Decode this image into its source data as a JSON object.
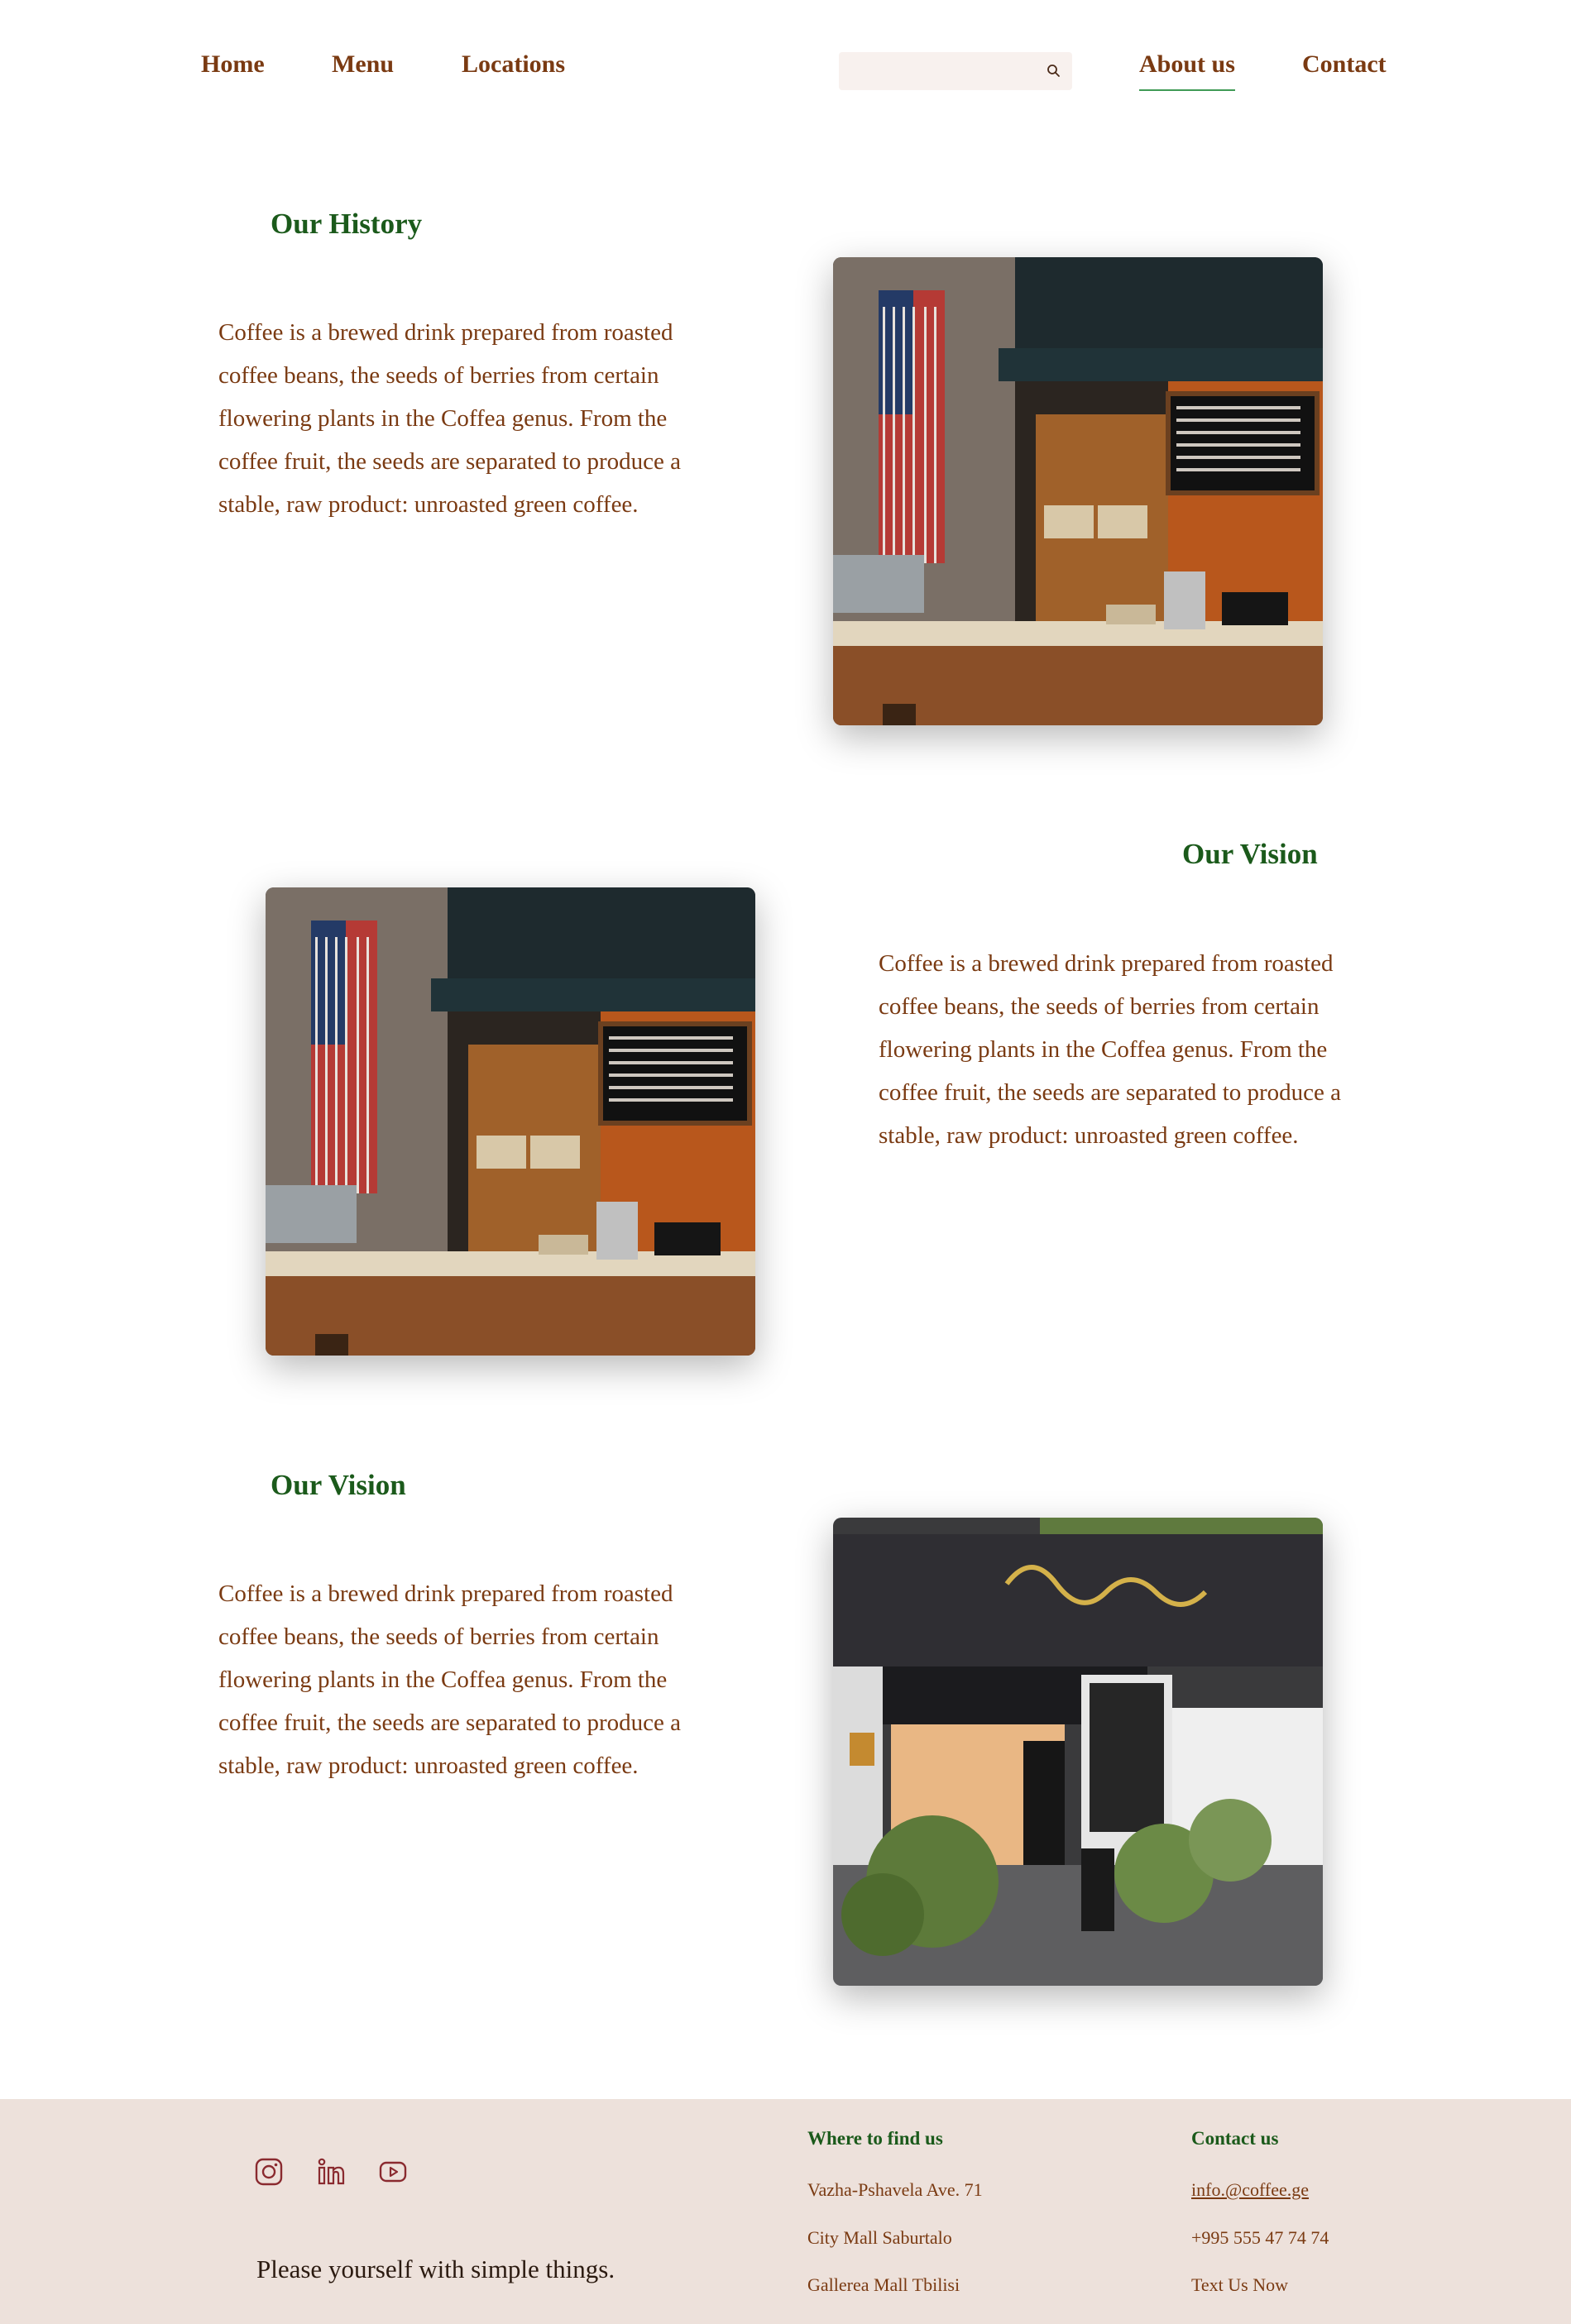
{
  "nav": {
    "home": "Home",
    "menu": "Menu",
    "locations": "Locations",
    "about": "About us",
    "contact": "Contact",
    "search_placeholder": ""
  },
  "sections": [
    {
      "heading": "Our History",
      "text": "Coffee is a brewed drink prepared from roasted coffee beans, the seeds of berries from certain flowering plants in the Coffea genus. From the coffee fruit, the seeds are separated to produce a stable, raw product: unroasted green coffee."
    },
    {
      "heading": "Our Vision",
      "text": "Coffee is a brewed drink prepared from roasted coffee beans, the seeds of berries from certain flowering plants in the Coffea genus. From the coffee fruit, the seeds are separated to produce a stable, raw product: unroasted green coffee."
    },
    {
      "heading": "Our Vision",
      "text": "Coffee is a brewed drink prepared from roasted coffee beans, the seeds of berries from certain flowering plants in the Coffea genus. From the coffee fruit, the seeds are separated to produce a stable, raw product: unroasted green coffee."
    }
  ],
  "footer": {
    "social": [
      "instagram-icon",
      "linkedin-icon",
      "youtube-icon"
    ],
    "tagline": "Please yourself with simple things.",
    "where": {
      "title": "Where to find us",
      "items": [
        "Vazha-Pshavela Ave. 71",
        "City Mall Saburtalo",
        "Gallerea Mall Tbilisi"
      ]
    },
    "contact": {
      "title": "Contact us",
      "email": "info.@coffee.ge",
      "phone": "+995 555 47 74 74",
      "text_us": "Text Us Now"
    }
  },
  "colors": {
    "brand_brown": "#7a3a12",
    "heading_green": "#1b5a1b",
    "footer_bg": "#ede1db",
    "active_underline": "#3f9a55"
  }
}
